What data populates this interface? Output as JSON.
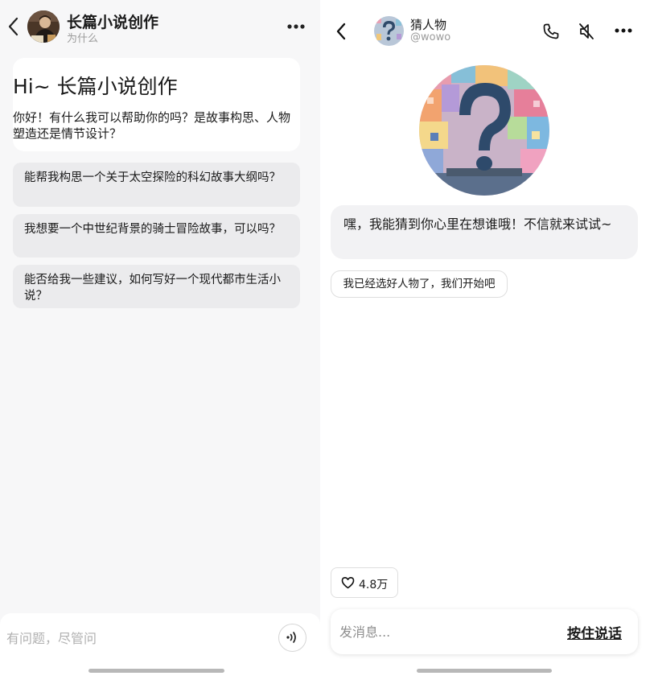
{
  "left": {
    "header": {
      "title": "长篇小说创作",
      "subtitle": "为什么",
      "back_icon": "chevron-left-icon",
      "more_icon": "ellipsis-icon"
    },
    "greeting": {
      "title": "Hi~ 长篇小说创作",
      "body": "你好！有什么我可以帮助你的吗？是故事构思、人物塑造还是情节设计？"
    },
    "suggestions": [
      {
        "text": "能帮我构思一个关于太空探险的科幻故事大纲吗？"
      },
      {
        "text": "我想要一个中世纪背景的骑士冒险故事，可以吗？"
      },
      {
        "text": "能否给我一些建议，如何写好一个现代都市生活小说？"
      }
    ],
    "input": {
      "placeholder": "有问题，尽管问",
      "voice_icon": "voice-wave-icon"
    }
  },
  "right": {
    "header": {
      "name": "猜人物",
      "handle": "@wowo",
      "phone_icon": "phone-icon",
      "mute_icon": "speaker-muted-icon",
      "more_icon": "ellipsis-icon"
    },
    "bot_message": "嘿，我能猜到你心里在想谁哦！不信就来试试~",
    "quick_reply": "我已经选好人物了，我们开始吧",
    "likes": {
      "count": "4.8万",
      "icon": "heart-icon"
    },
    "input": {
      "placeholder": "发消息...",
      "push_to_talk": "按住说话"
    }
  },
  "colors": {
    "left_background": "#f7f7f8",
    "suggestion_bg": "#ebebed",
    "bubble_bg": "#f2f2f4",
    "muted_text": "#9b9b9b"
  }
}
